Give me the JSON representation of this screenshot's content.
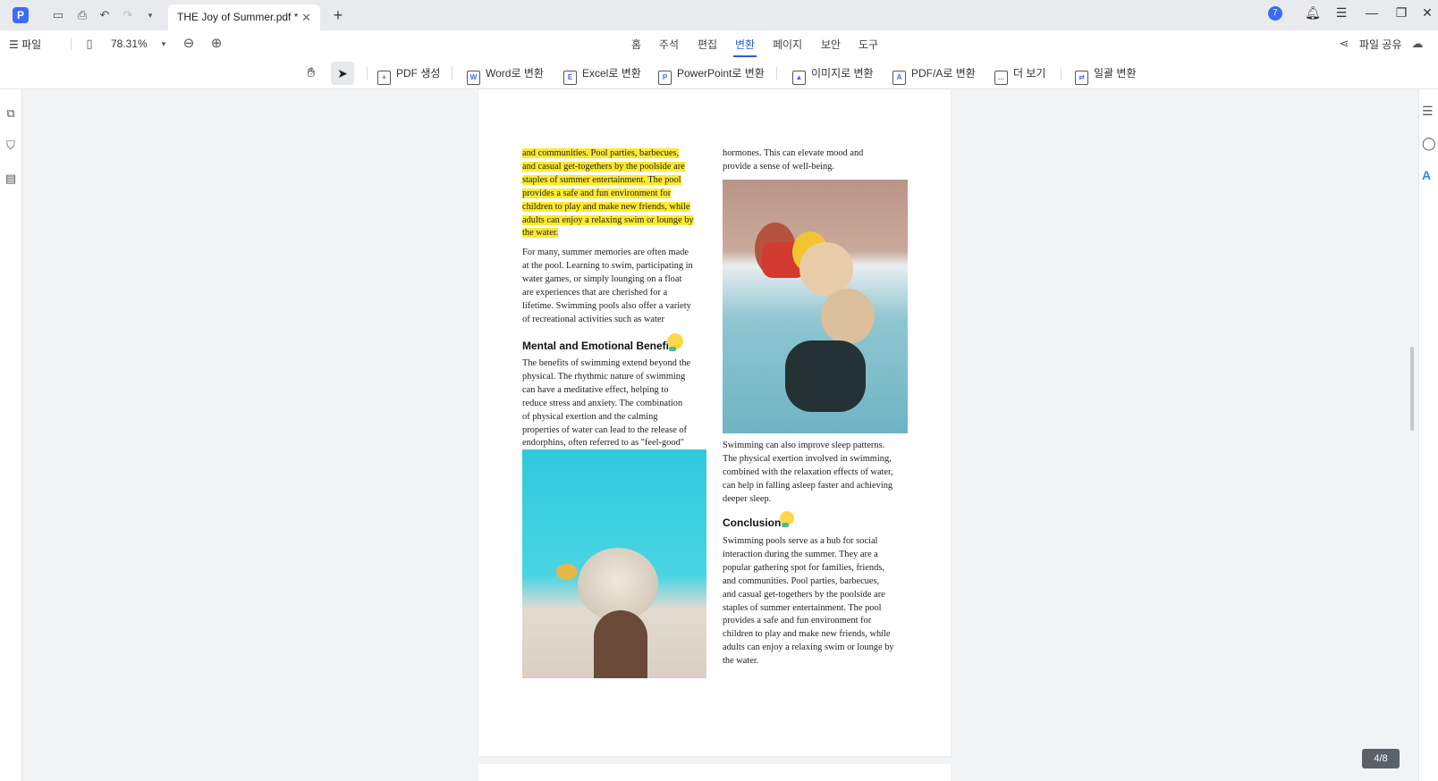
{
  "titlebar": {
    "tab_title": "THE Joy of Summer.pdf *",
    "notification_count": "7",
    "app_logo_letter": "P"
  },
  "menubar": {
    "file": "☰ 파일",
    "zoom": "78.31%",
    "tabs": [
      "홈",
      "주석",
      "편집",
      "변환",
      "페이지",
      "보안",
      "도구"
    ],
    "active_tab": "변환",
    "share": "파일 공유"
  },
  "toolbar": {
    "create_pdf": "PDF 생성",
    "to_word": "Word로 변환",
    "to_excel": "Excel로 변환",
    "to_powerpoint": "PowerPoint로 변환",
    "to_image": "이미지로 변환",
    "to_pdfa": "PDF/A로 변환",
    "more": "더 보기",
    "batch": "일괄 변환"
  },
  "document": {
    "left_col": {
      "highlighted_lines": [
        "and communities. Pool parties, barbecues,",
        "and casual get-togethers by the poolside are",
        "staples of summer entertainment. The pool",
        "provides a safe and fun environment for",
        "children to play and make new friends, while",
        "adults can enjoy a relaxing swim or lounge by",
        "the water."
      ],
      "para2": [
        "For many, summer memories are often made",
        "at the pool. Learning to swim, participating in",
        "water games, or simply lounging on a float",
        "are experiences that are cherished for a",
        "lifetime. Swimming pools also offer a variety",
        "of recreational activities such as water"
      ],
      "heading": "Mental and Emotional Benefits",
      "para3": [
        "The benefits of swimming extend beyond the",
        "physical. The rhythmic nature of swimming",
        "can have a meditative effect, helping to",
        "reduce stress and anxiety. The combination",
        "of physical exertion and the calming",
        "properties of water can lead to the release of",
        "endorphins, often referred to as \"feel-good\""
      ]
    },
    "right_col": {
      "top_lines": [
        "hormones. This can elevate mood and",
        "provide a sense of well-being."
      ],
      "sleep_para": [
        "Swimming can also improve sleep patterns.",
        "The physical exertion involved in swimming,",
        "combined with the relaxation effects of water,",
        "can help in falling asleep faster and achieving",
        "deeper sleep."
      ],
      "conclusion_heading": "Conclusion",
      "conclusion_para": [
        "Swimming pools serve as a hub for social",
        "interaction during the summer. They are a",
        "popular gathering spot for families, friends,",
        "and communities. Pool parties, barbecues,",
        "and casual get-togethers by the poolside are",
        "staples of summer entertainment. The pool",
        "provides a safe and fun environment for",
        "children to play and make new friends, while",
        "adults can enjoy a relaxing swim or lounge by",
        "the water."
      ]
    }
  },
  "page_counter": "4/8",
  "colors": {
    "accent": "#2d5bd9",
    "highlight": "#ffea2e"
  }
}
